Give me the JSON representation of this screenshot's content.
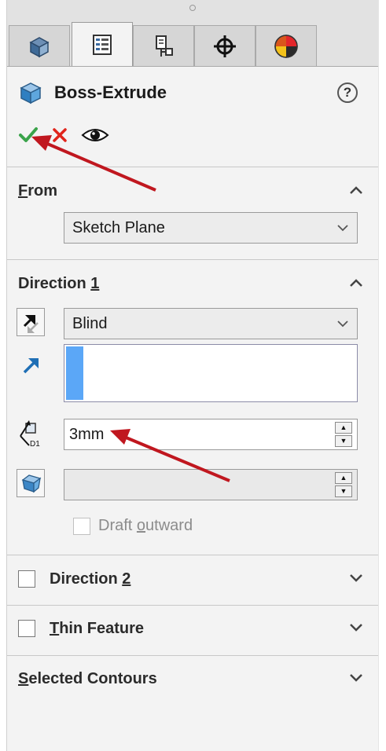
{
  "tabs": [
    {
      "icon": "feature-manager-icon"
    },
    {
      "icon": "property-manager-icon"
    },
    {
      "icon": "configuration-manager-icon"
    },
    {
      "icon": "dimxpert-manager-icon"
    },
    {
      "icon": "display-manager-icon"
    }
  ],
  "feature": {
    "title": "Boss-Extrude",
    "help_label": "?"
  },
  "from": {
    "title": "From",
    "title_underline": "F",
    "title_rest": "rom",
    "start_condition": "Sketch Plane"
  },
  "direction1": {
    "title_pre": "Direction ",
    "title_underline": "1",
    "end_condition": "Blind",
    "depth": "3mm",
    "draft_label_pre": "Draft ",
    "draft_label_u": "o",
    "draft_label_post": "utward"
  },
  "direction2": {
    "title_pre": "Direction ",
    "title_underline": "2"
  },
  "thin_feature": {
    "title_underline": "T",
    "title_rest": "hin Feature"
  },
  "selected_contours": {
    "title_underline": "S",
    "title_rest": "elected Contours"
  },
  "colors": {
    "accent": "#5ba7f7",
    "ok": "#3aa34a",
    "cancel": "#e0241b",
    "annotation_arrow": "#c0171f"
  }
}
